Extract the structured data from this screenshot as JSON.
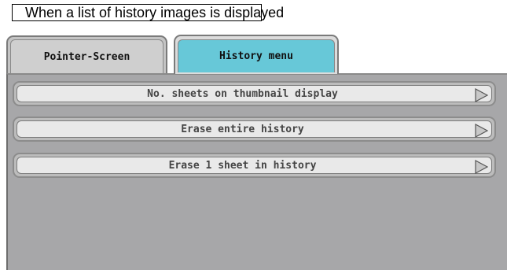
{
  "caption": "When a list of history images is displayed",
  "tabs": [
    {
      "label": "Pointer-Screen",
      "active": false
    },
    {
      "label": "History menu",
      "active": true,
      "color": "#67c8d8"
    }
  ],
  "menu": {
    "items": [
      {
        "label": "No. sheets on thumbnail display",
        "icon": "arrow-right-icon"
      },
      {
        "label": "Erase entire history",
        "icon": "arrow-right-icon"
      },
      {
        "label": "Erase 1 sheet in history",
        "icon": "arrow-right-icon"
      }
    ]
  },
  "colors": {
    "panel": "#a7a7a9",
    "button_face": "#e9e9e9",
    "active_tab": "#67c8d8"
  }
}
